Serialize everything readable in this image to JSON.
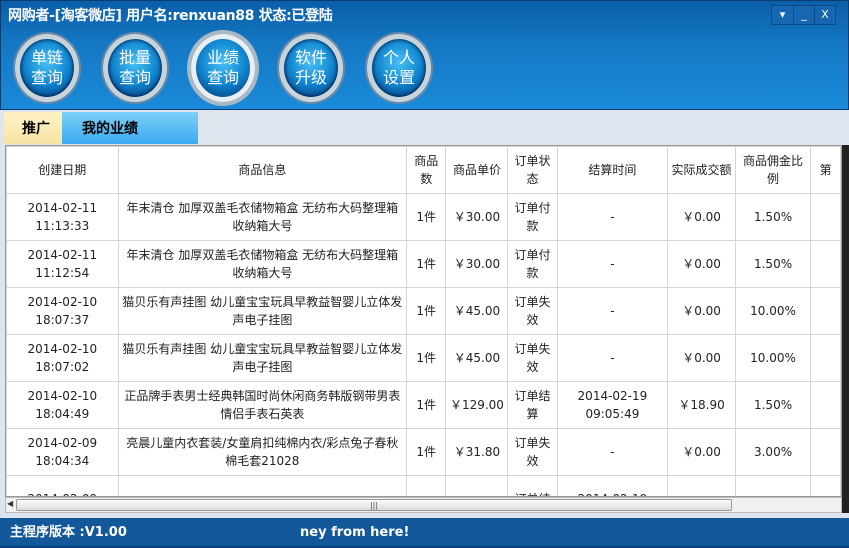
{
  "title": "网购者-[淘客微店] 用户名:renxuan88 状态:已登陆",
  "window_buttons": [
    "▾",
    "_",
    "X"
  ],
  "nav": [
    {
      "label": "单链查询"
    },
    {
      "label": "批量查询"
    },
    {
      "label": "业绩查询",
      "active": true
    },
    {
      "label": "软件升级"
    },
    {
      "label": "个人设置"
    }
  ],
  "tabs": [
    "推广媒体",
    "我的业绩"
  ],
  "table": {
    "columns": [
      "创建日期",
      "商品信息",
      "商品数",
      "商品单价",
      "订单状态",
      "结算时间",
      "实际成交额",
      "商品佣金比例",
      "第"
    ],
    "rows": [
      [
        "2014-02-11 11:13:33",
        "年末清仓 加厚双盖毛衣储物箱盒 无纺布大码整理箱收纳箱大号",
        "1件",
        "￥30.00",
        "订单付款",
        "-",
        "￥0.00",
        "1.50%",
        ""
      ],
      [
        "2014-02-11 11:12:54",
        "年末清仓 加厚双盖毛衣储物箱盒 无纺布大码整理箱收纳箱大号",
        "1件",
        "￥30.00",
        "订单付款",
        "-",
        "￥0.00",
        "1.50%",
        ""
      ],
      [
        "2014-02-10 18:07:37",
        "猫贝乐有声挂图 幼儿童宝宝玩具早教益智婴儿立体发声电子挂图",
        "1件",
        "￥45.00",
        "订单失效",
        "-",
        "￥0.00",
        "10.00%",
        ""
      ],
      [
        "2014-02-10 18:07:02",
        "猫贝乐有声挂图 幼儿童宝宝玩具早教益智婴儿立体发声电子挂图",
        "1件",
        "￥45.00",
        "订单失效",
        "-",
        "￥0.00",
        "10.00%",
        ""
      ],
      [
        "2014-02-10 18:04:49",
        "正品牌手表男士经典韩国时尚休闲商务韩版钢带男表情侣手表石英表",
        "1件",
        "￥129.00",
        "订单结算",
        "2014-02-19 09:05:49",
        "￥18.90",
        "1.50%",
        ""
      ],
      [
        "2014-02-09 18:04:34",
        "亮晨儿童内衣套装/女童肩扣纯棉内衣/彩点兔子春秋棉毛套21028",
        "1件",
        "￥31.80",
        "订单失效",
        "-",
        "￥0.00",
        "3.00%",
        ""
      ],
      [
        "2014-02-09",
        "",
        "",
        "",
        "订单结",
        "2014-02-19",
        "",
        "",
        ""
      ]
    ]
  },
  "status": {
    "version": "主程序版本 :V1.00",
    "marquee": "ney from here!"
  }
}
